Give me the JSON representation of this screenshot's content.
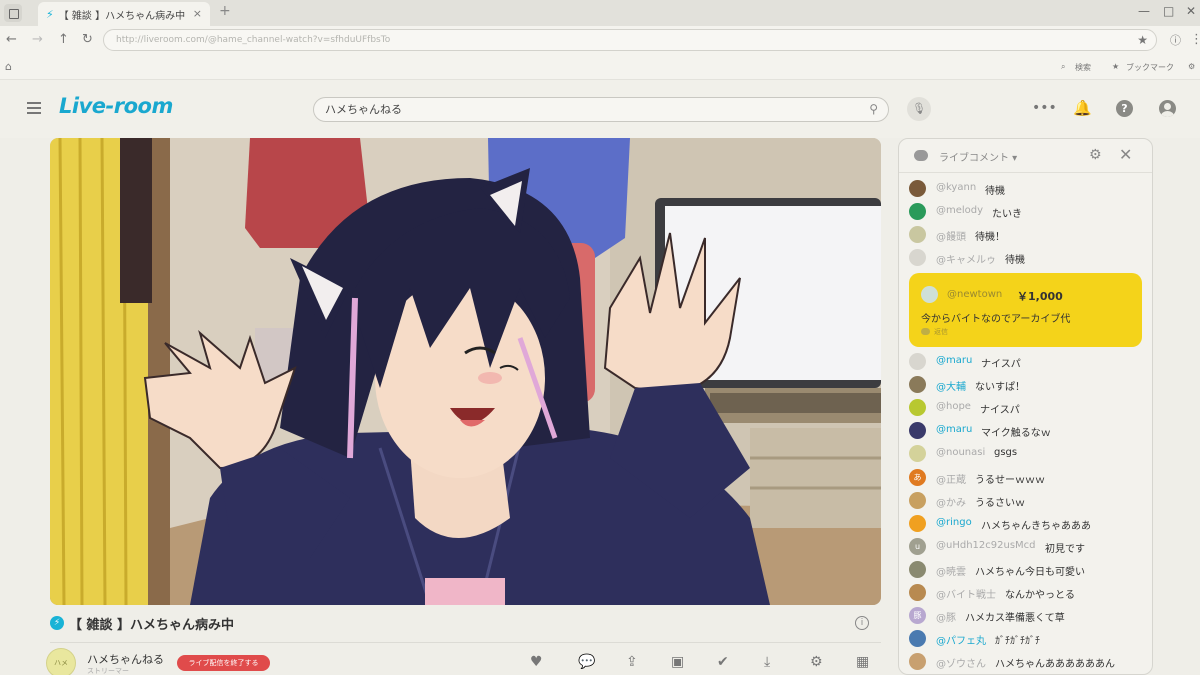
{
  "browser": {
    "tab_title": "【 雑談 】ハメちゃん病み中",
    "tab_close": "×",
    "new_tab": "+",
    "window_controls": [
      "—",
      "□",
      "✕"
    ],
    "url": "http://liveroom.com/@hame_channel-watch?v=sfhduUFfbsTo",
    "bookmark_search": "検索",
    "bookmark_bookmarks": "ブックマーク"
  },
  "site": {
    "logo": "Live-room",
    "search_value": "ハメちゃんねる"
  },
  "video": {
    "title": "【 雑談 】ハメちゃん病み中",
    "info_icon": "i"
  },
  "channel": {
    "name": "ハメちゃんねる",
    "sub": "ストリーマー",
    "avatar_text": "ハメ",
    "end_button": "ライブ配信を終了する"
  },
  "chat": {
    "title": "ライブコメント ▾",
    "messages_top": [
      {
        "user": "@kyann",
        "text": "待機",
        "color": "#7a5a3a",
        "hl": false
      },
      {
        "user": "@melody",
        "text": "たいき",
        "color": "#2a9a5a",
        "hl": false
      },
      {
        "user": "@饅頭",
        "text": "待機！",
        "color": "#c9c7a0",
        "hl": false
      },
      {
        "user": "@キャメルゥ",
        "text": "待機",
        "color": "#d8d6cf",
        "hl": false
      }
    ],
    "superchat": {
      "user": "@newtown",
      "amount": "￥1,000",
      "text": "今からバイトなのでアーカイブ代",
      "sub": "返信"
    },
    "messages": [
      {
        "user": "@maru",
        "text": "ナイスパ",
        "color": "#d8d6cf",
        "hl": true
      },
      {
        "user": "@大輔",
        "text": "ないすぱ！",
        "color": "#8a7a5a",
        "hl": true
      },
      {
        "user": "@hope",
        "text": "ナイスパ",
        "color": "#b8c830",
        "hl": false
      },
      {
        "user": "@maru",
        "text": "マイク触るなｗ",
        "color": "#3a3a6a",
        "hl": true
      },
      {
        "user": "@nounasi",
        "text": "gsgs",
        "color": "#d4d29a",
        "hl": false
      },
      {
        "user": "@正蔵",
        "text": "うるせーｗｗｗ",
        "color": "#e07a20",
        "hl": false,
        "initial": "あ"
      },
      {
        "user": "@かみ",
        "text": "うるさいｗ",
        "color": "#c8a060",
        "hl": false
      },
      {
        "user": "@ringo",
        "text": "ハメちゃんきちゃあああ",
        "color": "#f0a020",
        "hl": true
      },
      {
        "user": "@uHdh12c92usMcd",
        "text": "初見です",
        "color": "#a0a090",
        "hl": false,
        "initial": "u"
      },
      {
        "user": "@暁雲",
        "text": "ハメちゃん今日も可愛い",
        "color": "#8a8a70",
        "hl": false
      },
      {
        "user": "@バイト戦士",
        "text": "なんかやっとる",
        "color": "#b88a50",
        "hl": false
      },
      {
        "user": "@豚",
        "text": "ハメカス準備悪くて草",
        "color": "#b8a8d0",
        "hl": false,
        "initial": "豚"
      },
      {
        "user": "@パフェ丸",
        "text": "ｶﾞﾁｶﾞﾁｶﾞﾁ",
        "color": "#4a7ab0",
        "hl": true
      },
      {
        "user": "@ゾウさん",
        "text": "ハメちゃんああああああん",
        "color": "#c8a070",
        "hl": false
      }
    ]
  }
}
